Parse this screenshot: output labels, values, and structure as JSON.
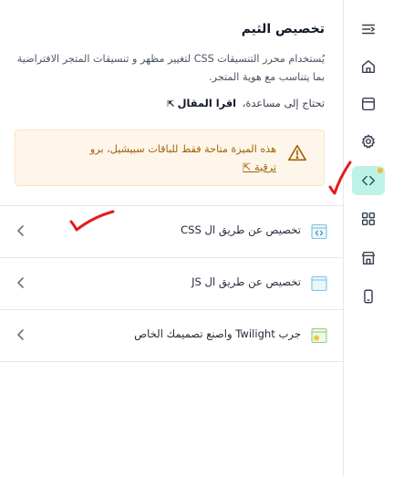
{
  "panel": {
    "title": "تخصيص الثيم",
    "description": "يُستخدام محرر التنسيقات CSS لتغيير مظهر و تنسيقات المتجر الافتراضية بما يتناسب مع هوية المتجر.",
    "help_prefix": "تحتاج إلى مساعدة،",
    "help_link": "اقرا المقال",
    "help_link_icon": "external-arrow-icon"
  },
  "alert": {
    "message": "هذه الميزة متاحة فقط للباقات سبيشيل، برو",
    "action": "ترقية",
    "action_icon": "external-arrow-icon",
    "icon": "warning-triangle-icon",
    "text_color": "#a16207",
    "background": "#fef6eb"
  },
  "options": [
    {
      "label": "تخصيص عن طريق ال CSS",
      "icon": "css-code-window-icon"
    },
    {
      "label": "تخصيص عن طريق ال JS",
      "icon": "browser-window-icon"
    },
    {
      "label": "جرب Twilight واصنع تصميمك الخاص",
      "icon": "twilight-window-icon"
    }
  ],
  "sidebar": {
    "items": [
      {
        "name": "menu-toggle-icon"
      },
      {
        "name": "home-icon"
      },
      {
        "name": "browser-icon"
      },
      {
        "name": "settings-icon"
      },
      {
        "name": "code-icon",
        "active": true
      },
      {
        "name": "apps-grid-icon"
      },
      {
        "name": "store-icon"
      },
      {
        "name": "mobile-icon"
      }
    ],
    "accent": "#bdf3e6",
    "notification_color": "#f6b73c"
  }
}
